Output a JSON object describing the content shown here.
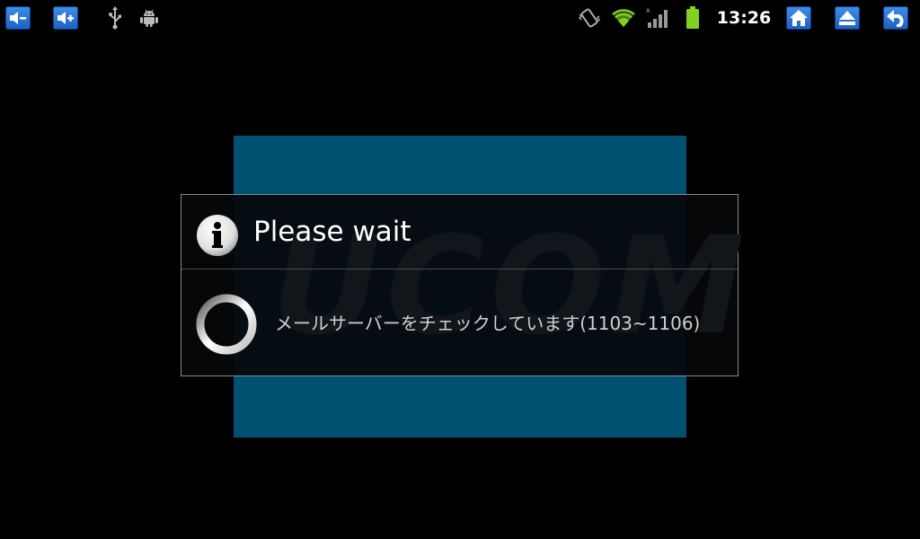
{
  "status_bar": {
    "left_buttons": [
      "volume-down-icon",
      "volume-up-icon"
    ],
    "notification_icons": [
      "usb-icon",
      "android-debug-icon"
    ],
    "system_icons": [
      "vibrate-icon",
      "wifi-icon",
      "signal-icon",
      "battery-icon"
    ],
    "clock": "13:26",
    "right_buttons": [
      "home-icon",
      "eject-icon",
      "back-icon"
    ],
    "button_color": "#2a75d8",
    "battery_color": "#7ed321"
  },
  "splash": {
    "watermark_text": "UCOM",
    "background_color": "#005171"
  },
  "dialog": {
    "title": "Please wait",
    "icon": "info-icon",
    "message": "メールサーバーをチェックしています(1103~1106)",
    "spinner": "progress-spinner-icon"
  }
}
